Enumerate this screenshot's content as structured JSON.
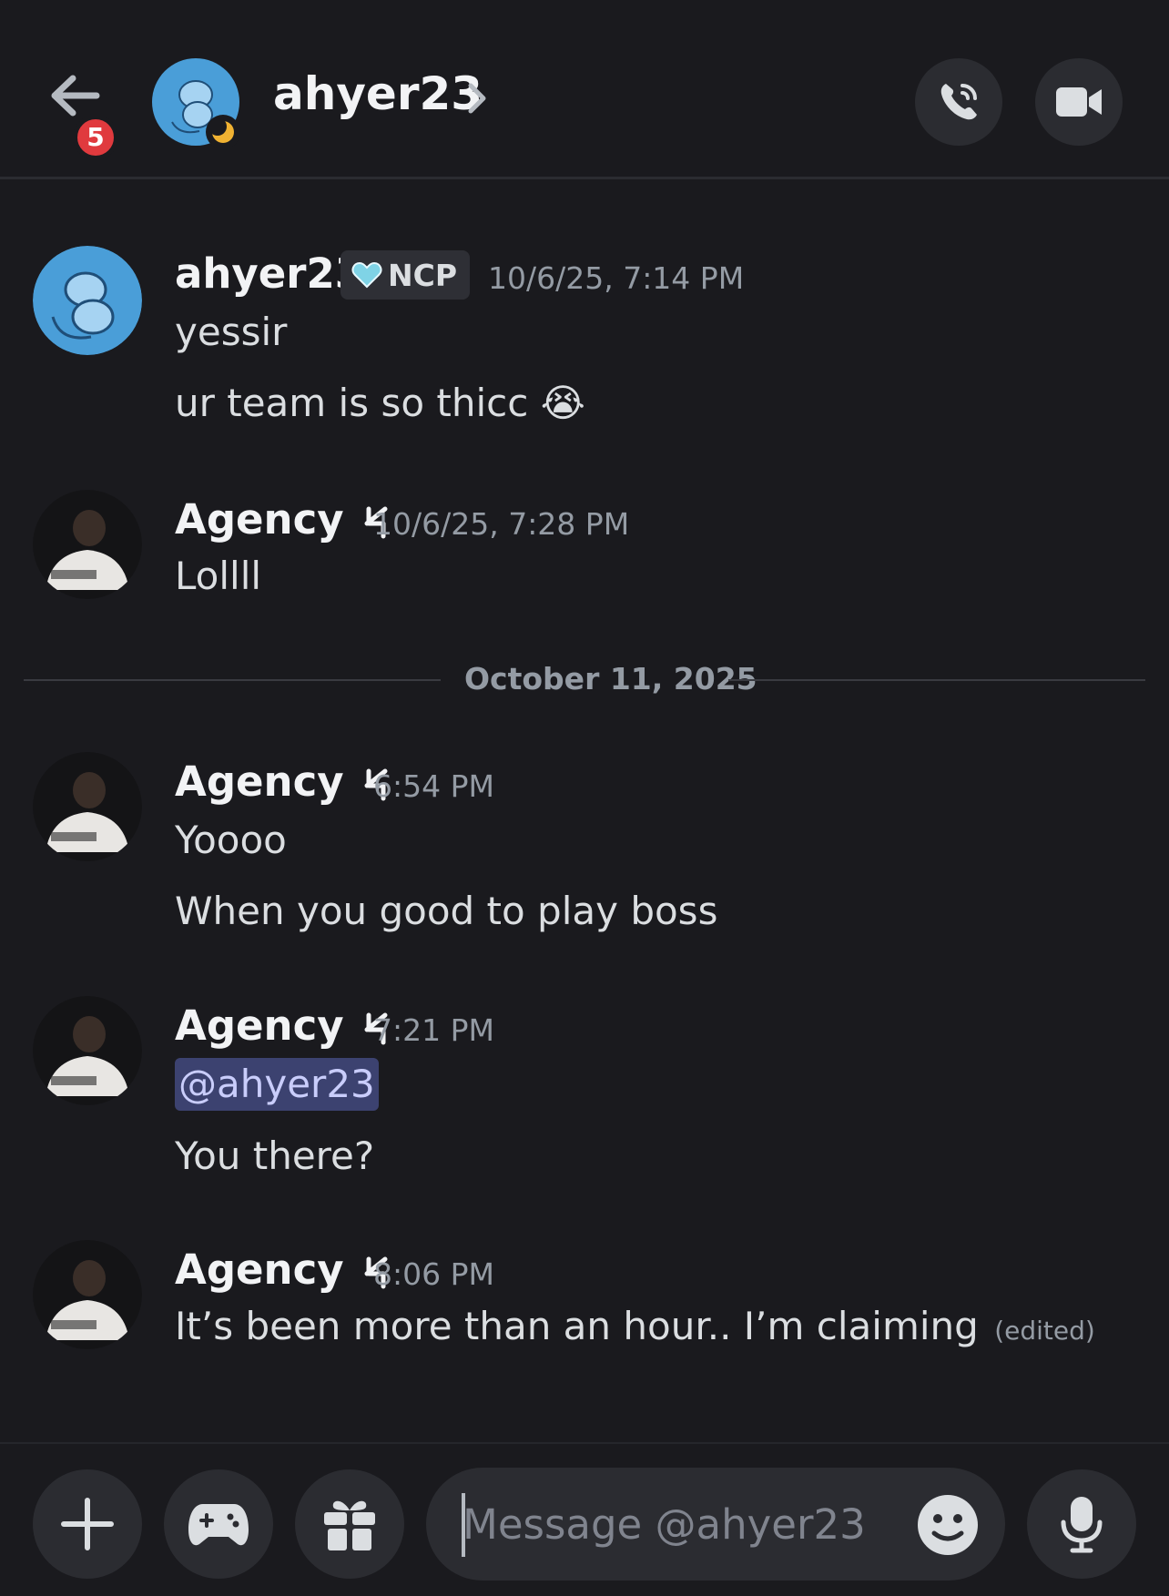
{
  "header": {
    "title": "ahyer23",
    "unread_count": "5",
    "status": "idle"
  },
  "messages": [
    {
      "author": "ahyer23",
      "badge": "NCP",
      "timestamp": "10/6/25, 7:14 PM",
      "lines": [
        "yessir",
        "ur team is so thicc"
      ],
      "emoji": "😭"
    },
    {
      "author": "Agency",
      "timestamp": "10/6/25, 7:28 PM",
      "lines": [
        "Lollll"
      ]
    },
    {
      "author": "Agency",
      "timestamp": "6:54 PM",
      "lines": [
        "Yoooo",
        "When you good to play boss"
      ]
    },
    {
      "author": "Agency",
      "timestamp": "7:21 PM",
      "mention": "@ahyer23",
      "lines": [
        "You there?"
      ]
    },
    {
      "author": "Agency",
      "timestamp": "8:06 PM",
      "lines": [
        "It’s been more than an hour.. I’m claiming"
      ],
      "edited_label": "(edited)"
    }
  ],
  "date_divider": "October 11, 2025",
  "composer": {
    "placeholder": "Message @ahyer23"
  },
  "colors": {
    "background": "#1a1a1e",
    "surface": "#2b2c31",
    "badge_red": "#e03a3e",
    "mention_bg": "#3c4270",
    "idle_moon": "#f0b232"
  },
  "icons": [
    "back-arrow-icon",
    "chevron-right-icon",
    "phone-icon",
    "video-camera-icon",
    "plus-icon",
    "gamepad-icon",
    "gift-icon",
    "emoji-icon",
    "microphone-icon",
    "bolt-icon",
    "heart-icon",
    "moon-icon"
  ]
}
